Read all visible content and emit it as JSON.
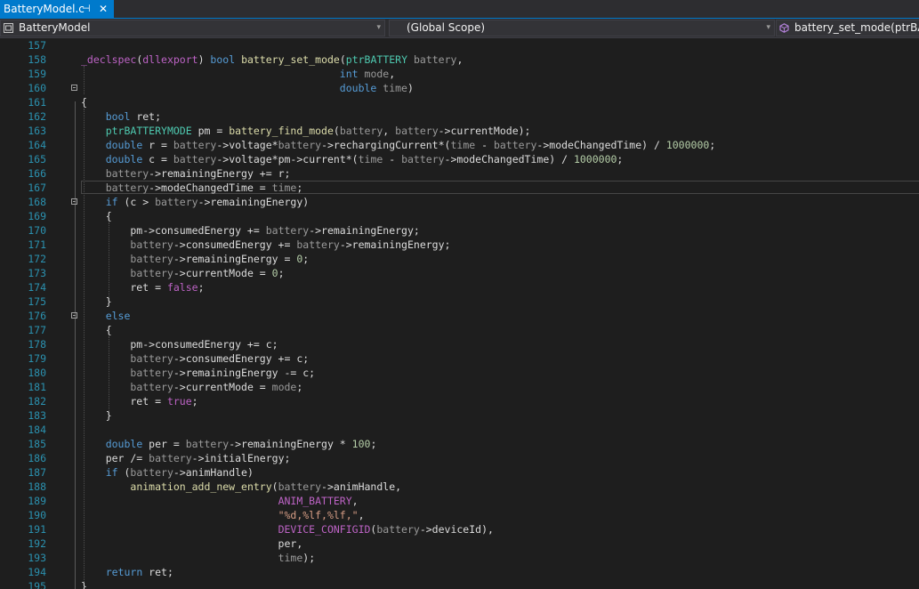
{
  "tab": {
    "title": "BatteryModel.c",
    "pin_icon": "pin-icon",
    "close_icon": "close-icon",
    "pin_glyph": "⊣",
    "close_glyph": "✕"
  },
  "nav": {
    "project": "BatteryModel",
    "scope": "(Global Scope)",
    "member": "battery_set_mode(ptrBATTERY battery, int mode, double time)",
    "arrow": "▾"
  },
  "colors": {
    "accent": "#007acc",
    "background": "#1e1e1e",
    "line_number": "#2b91af",
    "keyword": "#569cd6",
    "type": "#4ec9b0",
    "macro": "#bd63c5",
    "function": "#dcdcaa",
    "parameter": "#9a9a9a",
    "number": "#b5cea8",
    "string": "#d69d85"
  },
  "current_line": 167,
  "editor": {
    "lines": [
      {
        "n": "157",
        "tokens": []
      },
      {
        "n": "158",
        "tokens": [
          [
            "ma",
            "_declspec"
          ],
          [
            "pl",
            "("
          ],
          [
            "ma",
            "dllexport"
          ],
          [
            "pl",
            ") "
          ],
          [
            "kw",
            "bool"
          ],
          [
            "pl",
            " "
          ],
          [
            "fn",
            "battery_set_mode"
          ],
          [
            "pl",
            "("
          ],
          [
            "ty",
            "ptrBATTERY"
          ],
          [
            "pl",
            " "
          ],
          [
            "pa",
            "battery"
          ],
          [
            "pl",
            ","
          ]
        ]
      },
      {
        "n": "159",
        "tokens": [
          [
            "pl",
            "                                          "
          ],
          [
            "kw",
            "int"
          ],
          [
            "pl",
            " "
          ],
          [
            "pa",
            "mode"
          ],
          [
            "pl",
            ","
          ]
        ]
      },
      {
        "n": "160",
        "tokens": [
          [
            "pl",
            "                                          "
          ],
          [
            "kw",
            "double"
          ],
          [
            "pl",
            " "
          ],
          [
            "pa",
            "time"
          ],
          [
            "pl",
            ")"
          ]
        ]
      },
      {
        "n": "161",
        "tokens": [
          [
            "pl",
            "{"
          ]
        ]
      },
      {
        "n": "162",
        "tokens": [
          [
            "pl",
            "    "
          ],
          [
            "kw",
            "bool"
          ],
          [
            "pl",
            " ret;"
          ]
        ]
      },
      {
        "n": "163",
        "tokens": [
          [
            "pl",
            "    "
          ],
          [
            "ty",
            "ptrBATTERYMODE"
          ],
          [
            "pl",
            " pm = "
          ],
          [
            "fn",
            "battery_find_mode"
          ],
          [
            "pl",
            "("
          ],
          [
            "pa",
            "battery"
          ],
          [
            "pl",
            ", "
          ],
          [
            "pa",
            "battery"
          ],
          [
            "pl",
            "->currentMode);"
          ]
        ]
      },
      {
        "n": "164",
        "tokens": [
          [
            "pl",
            "    "
          ],
          [
            "kw",
            "double"
          ],
          [
            "pl",
            " r = "
          ],
          [
            "pa",
            "battery"
          ],
          [
            "pl",
            "->voltage*"
          ],
          [
            "pa",
            "battery"
          ],
          [
            "pl",
            "->rechargingCurrent*("
          ],
          [
            "pa",
            "time"
          ],
          [
            "pl",
            " - "
          ],
          [
            "pa",
            "battery"
          ],
          [
            "pl",
            "->modeChangedTime) / "
          ],
          [
            "nu",
            "1000000"
          ],
          [
            "pl",
            ";"
          ]
        ]
      },
      {
        "n": "165",
        "tokens": [
          [
            "pl",
            "    "
          ],
          [
            "kw",
            "double"
          ],
          [
            "pl",
            " c = "
          ],
          [
            "pa",
            "battery"
          ],
          [
            "pl",
            "->voltage*pm->current*("
          ],
          [
            "pa",
            "time"
          ],
          [
            "pl",
            " - "
          ],
          [
            "pa",
            "battery"
          ],
          [
            "pl",
            "->modeChangedTime) / "
          ],
          [
            "nu",
            "1000000"
          ],
          [
            "pl",
            ";"
          ]
        ]
      },
      {
        "n": "166",
        "tokens": [
          [
            "pl",
            "    "
          ],
          [
            "pa",
            "battery"
          ],
          [
            "pl",
            "->remainingEnergy += r;"
          ]
        ]
      },
      {
        "n": "167",
        "tokens": [
          [
            "pl",
            "    "
          ],
          [
            "pa",
            "battery"
          ],
          [
            "pl",
            "->modeChangedTime = "
          ],
          [
            "pa",
            "time"
          ],
          [
            "pl",
            ";"
          ]
        ]
      },
      {
        "n": "168",
        "tokens": [
          [
            "pl",
            "    "
          ],
          [
            "kw",
            "if"
          ],
          [
            "pl",
            " (c > "
          ],
          [
            "pa",
            "battery"
          ],
          [
            "pl",
            "->remainingEnergy)"
          ]
        ]
      },
      {
        "n": "169",
        "tokens": [
          [
            "pl",
            "    {"
          ]
        ]
      },
      {
        "n": "170",
        "tokens": [
          [
            "pl",
            "        pm->consumedEnergy += "
          ],
          [
            "pa",
            "battery"
          ],
          [
            "pl",
            "->remainingEnergy;"
          ]
        ]
      },
      {
        "n": "171",
        "tokens": [
          [
            "pl",
            "        "
          ],
          [
            "pa",
            "battery"
          ],
          [
            "pl",
            "->consumedEnergy += "
          ],
          [
            "pa",
            "battery"
          ],
          [
            "pl",
            "->remainingEnergy;"
          ]
        ]
      },
      {
        "n": "172",
        "tokens": [
          [
            "pl",
            "        "
          ],
          [
            "pa",
            "battery"
          ],
          [
            "pl",
            "->remainingEnergy = "
          ],
          [
            "nu",
            "0"
          ],
          [
            "pl",
            ";"
          ]
        ]
      },
      {
        "n": "173",
        "tokens": [
          [
            "pl",
            "        "
          ],
          [
            "pa",
            "battery"
          ],
          [
            "pl",
            "->currentMode = "
          ],
          [
            "nu",
            "0"
          ],
          [
            "pl",
            ";"
          ]
        ]
      },
      {
        "n": "174",
        "tokens": [
          [
            "pl",
            "        ret = "
          ],
          [
            "ma",
            "false"
          ],
          [
            "pl",
            ";"
          ]
        ]
      },
      {
        "n": "175",
        "tokens": [
          [
            "pl",
            "    }"
          ]
        ]
      },
      {
        "n": "176",
        "tokens": [
          [
            "pl",
            "    "
          ],
          [
            "kw",
            "else"
          ]
        ]
      },
      {
        "n": "177",
        "tokens": [
          [
            "pl",
            "    {"
          ]
        ]
      },
      {
        "n": "178",
        "tokens": [
          [
            "pl",
            "        pm->consumedEnergy += c;"
          ]
        ]
      },
      {
        "n": "179",
        "tokens": [
          [
            "pl",
            "        "
          ],
          [
            "pa",
            "battery"
          ],
          [
            "pl",
            "->consumedEnergy += c;"
          ]
        ]
      },
      {
        "n": "180",
        "tokens": [
          [
            "pl",
            "        "
          ],
          [
            "pa",
            "battery"
          ],
          [
            "pl",
            "->remainingEnergy -= c;"
          ]
        ]
      },
      {
        "n": "181",
        "tokens": [
          [
            "pl",
            "        "
          ],
          [
            "pa",
            "battery"
          ],
          [
            "pl",
            "->currentMode = "
          ],
          [
            "pa",
            "mode"
          ],
          [
            "pl",
            ";"
          ]
        ]
      },
      {
        "n": "182",
        "tokens": [
          [
            "pl",
            "        ret = "
          ],
          [
            "ma",
            "true"
          ],
          [
            "pl",
            ";"
          ]
        ]
      },
      {
        "n": "183",
        "tokens": [
          [
            "pl",
            "    }"
          ]
        ]
      },
      {
        "n": "184",
        "tokens": []
      },
      {
        "n": "185",
        "tokens": [
          [
            "pl",
            "    "
          ],
          [
            "kw",
            "double"
          ],
          [
            "pl",
            " per = "
          ],
          [
            "pa",
            "battery"
          ],
          [
            "pl",
            "->remainingEnergy * "
          ],
          [
            "nu",
            "100"
          ],
          [
            "pl",
            ";"
          ]
        ]
      },
      {
        "n": "186",
        "tokens": [
          [
            "pl",
            "    per /= "
          ],
          [
            "pa",
            "battery"
          ],
          [
            "pl",
            "->initialEnergy;"
          ]
        ]
      },
      {
        "n": "187",
        "tokens": [
          [
            "pl",
            "    "
          ],
          [
            "kw",
            "if"
          ],
          [
            "pl",
            " ("
          ],
          [
            "pa",
            "battery"
          ],
          [
            "pl",
            "->animHandle)"
          ]
        ]
      },
      {
        "n": "188",
        "tokens": [
          [
            "pl",
            "        "
          ],
          [
            "fn",
            "animation_add_new_entry"
          ],
          [
            "pl",
            "("
          ],
          [
            "pa",
            "battery"
          ],
          [
            "pl",
            "->animHandle,"
          ]
        ]
      },
      {
        "n": "189",
        "tokens": [
          [
            "pl",
            "                                "
          ],
          [
            "ma",
            "ANIM_BATTERY"
          ],
          [
            "pl",
            ","
          ]
        ]
      },
      {
        "n": "190",
        "tokens": [
          [
            "pl",
            "                                "
          ],
          [
            "st",
            "\"%d,%lf,%lf,\""
          ],
          [
            "pl",
            ","
          ]
        ]
      },
      {
        "n": "191",
        "tokens": [
          [
            "pl",
            "                                "
          ],
          [
            "ma",
            "DEVICE_CONFIGID"
          ],
          [
            "pl",
            "("
          ],
          [
            "pa",
            "battery"
          ],
          [
            "pl",
            "->deviceId),"
          ]
        ]
      },
      {
        "n": "192",
        "tokens": [
          [
            "pl",
            "                                per,"
          ]
        ]
      },
      {
        "n": "193",
        "tokens": [
          [
            "pl",
            "                                "
          ],
          [
            "pa",
            "time"
          ],
          [
            "pl",
            ");"
          ]
        ]
      },
      {
        "n": "194",
        "tokens": [
          [
            "pl",
            "    "
          ],
          [
            "kw",
            "return"
          ],
          [
            "pl",
            " ret;"
          ]
        ]
      },
      {
        "n": "195",
        "tokens": [
          [
            "pl",
            "}"
          ]
        ]
      }
    ]
  }
}
